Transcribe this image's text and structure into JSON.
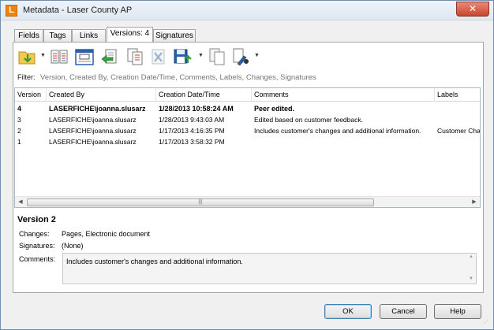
{
  "window": {
    "title": "Metadata - Laser County AP",
    "app_icon_letter": "L",
    "close_glyph": "✕"
  },
  "tabs": [
    {
      "label": "Fields",
      "active": false
    },
    {
      "label": "Tags",
      "active": false
    },
    {
      "label": "Links",
      "active": false
    },
    {
      "label": "Versions: 4",
      "active": true
    },
    {
      "label": "Signatures",
      "active": false
    }
  ],
  "toolbar": {
    "buttons": [
      "get-version-icon",
      "compare-versions-icon",
      "version-properties-icon",
      "revert-version-icon",
      "new-version-icon",
      "delete-version-icon",
      "save-version-icon",
      "copy-version-icon",
      "export-version-icon"
    ]
  },
  "filter": {
    "label": "Filter:",
    "placeholder": "Version, Created By, Creation Date/Time, Comments, Labels, Changes, Signatures"
  },
  "grid": {
    "columns": [
      "Version",
      "Created By",
      "Creation Date/Time",
      "Comments",
      "Labels"
    ],
    "rows": [
      {
        "version": "4",
        "created_by": "LASERFICHE\\joanna.slusarz",
        "date": "1/28/2013 10:58:24 AM",
        "comments": "Peer edited.",
        "labels": "",
        "bold": true
      },
      {
        "version": "3",
        "created_by": "LASERFICHE\\joanna.slusarz",
        "date": "1/28/2013 9:43:03 AM",
        "comments": "Edited based on customer feedback.",
        "labels": "",
        "bold": false
      },
      {
        "version": "2",
        "created_by": "LASERFICHE\\joanna.slusarz",
        "date": "1/17/2013 4:16:35 PM",
        "comments": "Includes customer's changes and additional information.",
        "labels": "Customer Cha",
        "bold": false
      },
      {
        "version": "1",
        "created_by": "LASERFICHE\\joanna.slusarz",
        "date": "1/17/2013 3:58:32 PM",
        "comments": "",
        "labels": "",
        "bold": false
      }
    ],
    "scroll_left": "◀",
    "scroll_right": "▶",
    "thumb_grip": "|||"
  },
  "detail": {
    "title": "Version 2",
    "changes_label": "Changes:",
    "changes_value": "Pages, Electronic document",
    "signatures_label": "Signatures:",
    "signatures_value": "(None)",
    "comments_label": "Comments:",
    "comments_value": "Includes customer's changes and additional information."
  },
  "buttons": {
    "ok": "OK",
    "cancel": "Cancel",
    "help": "Help"
  },
  "colors": {
    "accent_orange": "#f0830a",
    "title_close": "#c9432d",
    "selection_blue": "#3c7fb1"
  }
}
